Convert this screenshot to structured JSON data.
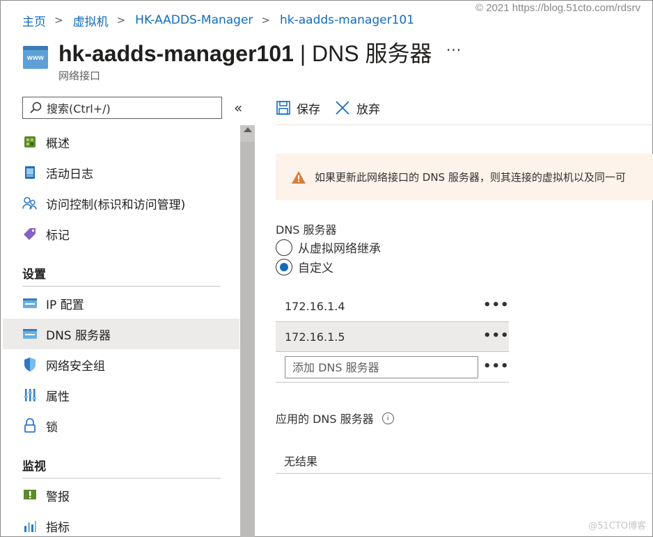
{
  "watermark_top": "© 2021 https://blog.51cto.com/rdsrv",
  "watermark_bottom": "@51CTO博客",
  "breadcrumb": {
    "items": [
      "主页",
      "虚拟机",
      "HK-AADDS-Manager",
      "hk-aadds-manager101"
    ],
    "separator": ">"
  },
  "header": {
    "icon_text": "www",
    "resource_name": "hk-aadds-manager101",
    "divider": " | ",
    "blade_title": "DNS 服务器",
    "more": "···",
    "subtitle": "网络接口"
  },
  "sidebar": {
    "search_placeholder": "搜索(Ctrl+/)",
    "collapse": "«",
    "top_items": [
      {
        "label": "概述",
        "icon": "overview-icon"
      },
      {
        "label": "活动日志",
        "icon": "activity-log-icon"
      },
      {
        "label": "访问控制(标识和访问管理)",
        "icon": "iam-icon"
      },
      {
        "label": "标记",
        "icon": "tag-icon"
      }
    ],
    "settings_header": "设置",
    "settings_items": [
      {
        "label": "IP 配置",
        "icon": "ip-config-icon"
      },
      {
        "label": "DNS 服务器",
        "icon": "dns-server-icon",
        "active": true
      },
      {
        "label": "网络安全组",
        "icon": "nsg-shield-icon"
      },
      {
        "label": "属性",
        "icon": "properties-icon"
      },
      {
        "label": "锁",
        "icon": "lock-icon"
      }
    ],
    "monitoring_header": "监视",
    "monitoring_items": [
      {
        "label": "警报",
        "icon": "alert-icon"
      },
      {
        "label": "指标",
        "icon": "metrics-icon"
      }
    ]
  },
  "toolbar": {
    "save_label": "保存",
    "discard_label": "放弃"
  },
  "warning": {
    "text": "如果更新此网络接口的 DNS 服务器，则其连接的虚拟机以及同一可"
  },
  "dns": {
    "section_label": "DNS 服务器",
    "inherit_label": "从虚拟网络继承",
    "custom_label": "自定义",
    "selected": "custom",
    "servers": [
      "172.16.1.4",
      "172.16.1.5"
    ],
    "row_more": "•••",
    "add_placeholder": "添加 DNS 服务器"
  },
  "applied": {
    "label": "应用的 DNS 服务器",
    "info": "i",
    "no_result": "无结果"
  },
  "colors": {
    "link": "#0f6cbd",
    "warning_bg": "#fdf3ea",
    "warning_icon": "#d67f3c",
    "active_row": "#edebe9"
  }
}
